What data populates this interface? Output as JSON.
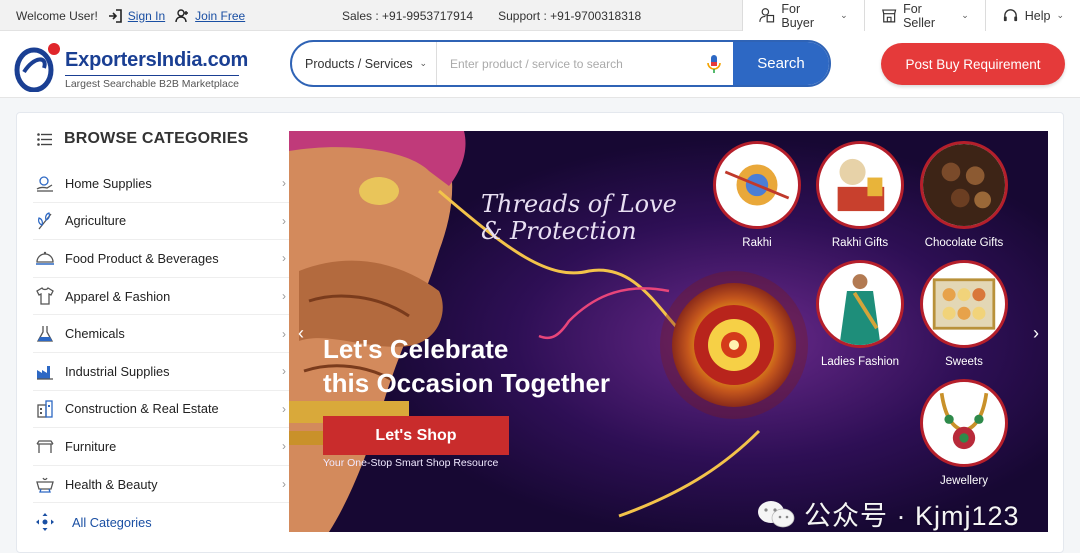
{
  "topbar": {
    "welcome": "Welcome User!",
    "signin": "Sign In",
    "join": "Join Free",
    "sales": "Sales : +91-9953717914",
    "support": "Support : +91-9700318318",
    "buyer": "For Buyer",
    "seller": "For Seller",
    "help": "Help"
  },
  "header": {
    "brand": "ExportersIndia.com",
    "tagline": "Largest Searchable B2B Marketplace",
    "search_category": "Products / Services",
    "search_placeholder": "Enter product / service to search",
    "search_button": "Search",
    "post_button": "Post Buy Requirement"
  },
  "categories": {
    "title": "BROWSE CATEGORIES",
    "items": [
      {
        "label": "Home Supplies",
        "icon": "home-supplies-icon"
      },
      {
        "label": "Agriculture",
        "icon": "agriculture-icon"
      },
      {
        "label": "Food Product & Beverages",
        "icon": "food-icon"
      },
      {
        "label": "Apparel & Fashion",
        "icon": "apparel-icon"
      },
      {
        "label": "Chemicals",
        "icon": "chemicals-icon"
      },
      {
        "label": "Industrial Supplies",
        "icon": "industrial-icon"
      },
      {
        "label": "Construction & Real Estate",
        "icon": "construction-icon"
      },
      {
        "label": "Furniture",
        "icon": "furniture-icon"
      },
      {
        "label": "Health & Beauty",
        "icon": "health-icon"
      }
    ],
    "all_label": "All Categories"
  },
  "banner": {
    "tagline_line1": "Threads of Love",
    "tagline_line2": "& Protection",
    "headline_line1": "Let's Celebrate",
    "headline_line2": "this Occasion Together",
    "cta": "Let's Shop",
    "subtext": "Your One-Stop Smart Shop Resource",
    "tiles": [
      {
        "label": "Rakhi"
      },
      {
        "label": "Rakhi Gifts"
      },
      {
        "label": "Chocolate Gifts"
      },
      {
        "label": "Ladies Fashion"
      },
      {
        "label": "Sweets"
      },
      {
        "label": "Jewellery"
      }
    ]
  },
  "watermark": "公众号 · Kjmj123",
  "colors": {
    "brand_blue": "#1a3f93",
    "search_blue": "#2d68c4",
    "post_red": "#e53a3a",
    "shop_red": "#c92c2c",
    "banner_bg": "#1d0a3b"
  }
}
